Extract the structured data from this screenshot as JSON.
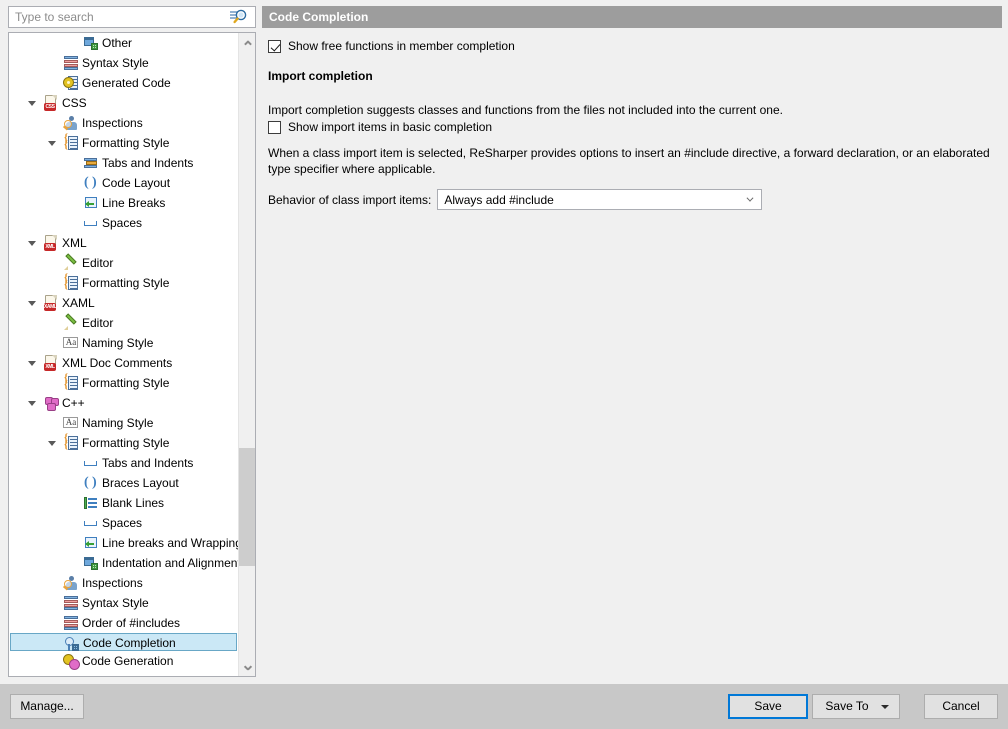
{
  "search": {
    "placeholder": "Type to search",
    "value": "",
    "icon": "search-icon"
  },
  "tree": {
    "items": [
      {
        "label": "Other",
        "level": 3,
        "icon": "window-grid-icon",
        "expander": "none"
      },
      {
        "label": "Syntax Style",
        "level": 2,
        "icon": "syntax-bars-icon",
        "expander": "none"
      },
      {
        "label": "Generated Code",
        "level": 2,
        "icon": "generated-code-icon",
        "expander": "none"
      },
      {
        "label": "CSS",
        "level": 1,
        "icon": "css-file-icon",
        "expander": "expanded"
      },
      {
        "label": "Inspections",
        "level": 2,
        "icon": "inspections-icon",
        "expander": "none"
      },
      {
        "label": "Formatting Style",
        "level": 2,
        "icon": "formatting-style-icon",
        "expander": "expanded"
      },
      {
        "label": "Tabs and Indents",
        "level": 3,
        "icon": "tabs-indents-icon",
        "expander": "none"
      },
      {
        "label": "Code Layout",
        "level": 3,
        "icon": "braces-icon",
        "expander": "none"
      },
      {
        "label": "Line Breaks",
        "level": 3,
        "icon": "line-breaks-icon",
        "expander": "none"
      },
      {
        "label": "Spaces",
        "level": 3,
        "icon": "spaces-icon",
        "expander": "none"
      },
      {
        "label": "XML",
        "level": 1,
        "icon": "xml-file-icon",
        "expander": "expanded"
      },
      {
        "label": "Editor",
        "level": 2,
        "icon": "pencil-icon",
        "expander": "none"
      },
      {
        "label": "Formatting Style",
        "level": 2,
        "icon": "formatting-style-icon",
        "expander": "none"
      },
      {
        "label": "XAML",
        "level": 1,
        "icon": "xaml-file-icon",
        "expander": "expanded"
      },
      {
        "label": "Editor",
        "level": 2,
        "icon": "pencil-icon",
        "expander": "none"
      },
      {
        "label": "Naming Style",
        "level": 2,
        "icon": "naming-style-icon",
        "expander": "none"
      },
      {
        "label": "XML Doc Comments",
        "level": 1,
        "icon": "xml-file-icon",
        "expander": "expanded"
      },
      {
        "label": "Formatting Style",
        "level": 2,
        "icon": "formatting-style-icon",
        "expander": "none"
      },
      {
        "label": "C++",
        "level": 1,
        "icon": "cpp-icon",
        "expander": "expanded"
      },
      {
        "label": "Naming Style",
        "level": 2,
        "icon": "naming-style-icon",
        "expander": "none"
      },
      {
        "label": "Formatting Style",
        "level": 2,
        "icon": "formatting-style-icon",
        "expander": "expanded"
      },
      {
        "label": "Tabs and Indents",
        "level": 3,
        "icon": "spaces-icon",
        "expander": "none"
      },
      {
        "label": "Braces Layout",
        "level": 3,
        "icon": "braces-icon",
        "expander": "none"
      },
      {
        "label": "Blank Lines",
        "level": 3,
        "icon": "blank-lines-icon",
        "expander": "none"
      },
      {
        "label": "Spaces",
        "level": 3,
        "icon": "spaces-icon",
        "expander": "none"
      },
      {
        "label": "Line breaks and Wrapping",
        "level": 3,
        "icon": "line-breaks-icon",
        "expander": "none"
      },
      {
        "label": "Indentation and Alignment",
        "level": 3,
        "icon": "window-grid-icon",
        "expander": "none"
      },
      {
        "label": "Inspections",
        "level": 2,
        "icon": "inspections-icon",
        "expander": "none"
      },
      {
        "label": "Syntax Style",
        "level": 2,
        "icon": "syntax-bars-icon",
        "expander": "none"
      },
      {
        "label": "Order of #includes",
        "level": 2,
        "icon": "syntax-bars-icon",
        "expander": "none"
      },
      {
        "label": "Code Completion",
        "level": 2,
        "icon": "code-completion-icon",
        "expander": "none",
        "selected": true
      },
      {
        "label": "Code Generation",
        "level": 2,
        "icon": "code-generation-icon",
        "expander": "none"
      }
    ],
    "scrollbar": {
      "up_icon": "chevron-up-icon",
      "down_icon": "chevron-down-icon"
    }
  },
  "page": {
    "header": "Code Completion",
    "show_free_functions": {
      "label": "Show free functions in member completion",
      "checked": true
    },
    "import_section": {
      "title": "Import completion",
      "description": "Import completion suggests classes and functions from the files not included into the current one.",
      "show_import_items": {
        "label": "Show import items in basic completion",
        "checked": false
      },
      "note": "When a class import item is selected, ReSharper provides options to insert an #include directive, a forward declaration, or an elaborated type specifier where applicable.",
      "behavior_label": "Behavior of class import items:",
      "behavior_value": "Always add #include",
      "behavior_arrow": "chevron-down-icon"
    }
  },
  "footer": {
    "manage": "Manage...",
    "save": "Save",
    "save_to": "Save To",
    "save_to_arrow": "triangle-down-icon",
    "cancel": "Cancel"
  },
  "colors": {
    "header_bar": "#9d9d9d",
    "selection": "#cbe8f6",
    "selection_border": "#68a7c6",
    "focus_border": "#0078d7",
    "dialog_bg": "#f0f0f0",
    "footer_bg": "#c8c8c8"
  }
}
